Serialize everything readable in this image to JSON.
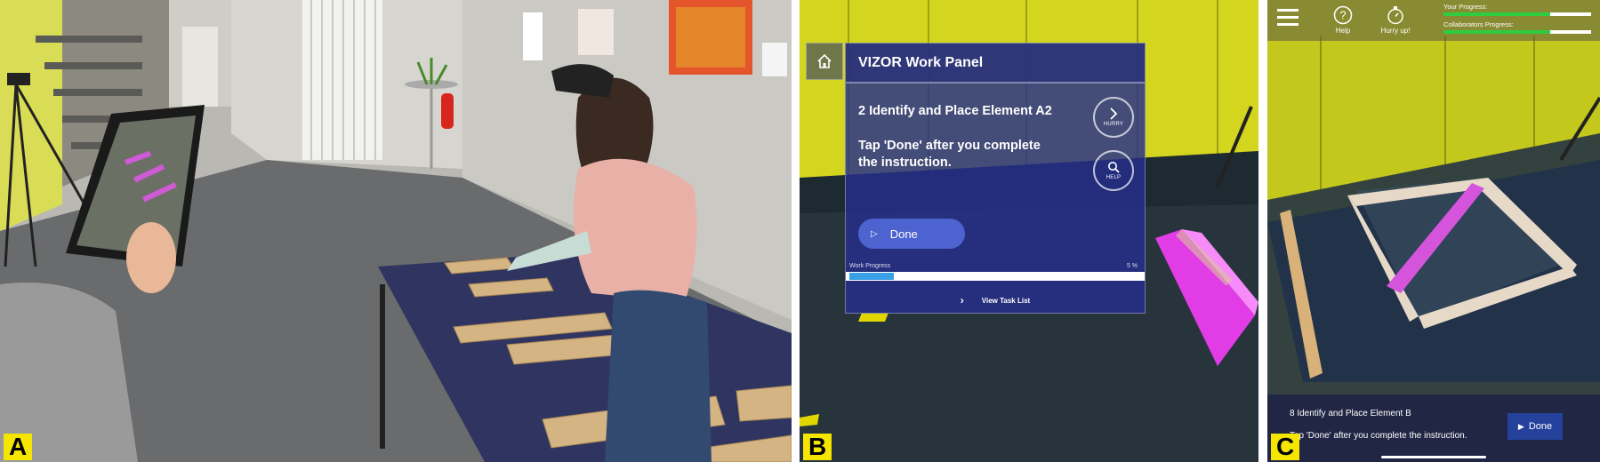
{
  "labels": {
    "a": "A",
    "b": "B",
    "c": "C"
  },
  "vizor": {
    "header": "VIZOR Work Panel",
    "step_title": "2 Identify and Place Element A2",
    "instruction": "Tap 'Done' after you complete the instruction.",
    "hurry_label": "HURRY",
    "help_label": "HELP",
    "done_label": "Done",
    "work_progress_label": "Work Progress",
    "work_progress_text": "5 %",
    "work_progress_value": 5,
    "task_list_label": "View Task List"
  },
  "tablet": {
    "help_label": "Help",
    "hurry_label": "Hurry up!",
    "your_progress_label": "Your Progress:",
    "your_progress_value": 0.72,
    "collab_progress_label": "Collaborators Progress:",
    "collab_progress_value": 0.72,
    "step_title": "8 Identify and Place Element B",
    "instruction": "Tap 'Done' after you complete the instruction.",
    "done_label": "Done"
  },
  "colors": {
    "vizor_panel": "#242e8c",
    "done_pill": "#4d63cf",
    "progress_blue": "#3aa0e6",
    "progress_green": "#2ecc40",
    "highlight_magenta": "#e23ce6",
    "label_yellow": "#f5e600"
  }
}
